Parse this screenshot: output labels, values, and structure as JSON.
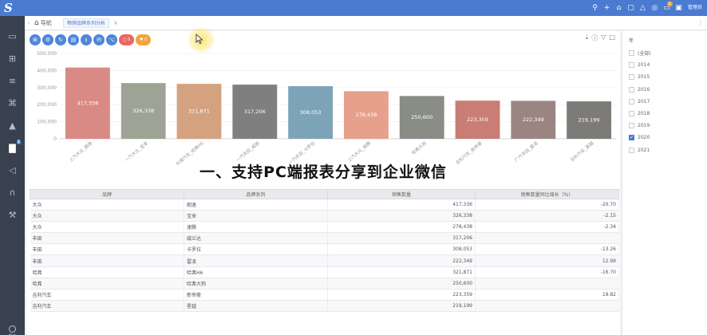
{
  "app": {
    "tab_home_label": "导航",
    "tab_active_label": "畅销品牌系列分析",
    "user_label": "管理员",
    "sidebar_bottom_label": "导航",
    "notification_badge": "5",
    "sidebar_badge": "1"
  },
  "toolbar": {
    "btn_count_a": "0",
    "btn_count_b": "0"
  },
  "banner": "一、支持PC端报表分享到企业微信",
  "chart_data": {
    "type": "bar",
    "categories": [
      "上汽大众_朗逸",
      "一汽大众_宝来",
      "长城汽车_哈弗H6",
      "一汽丰田_威驰",
      "一汽丰田_卡罗拉",
      "上汽大众_速腾",
      "哈弗大狗",
      "吉利汽车_新帝豪",
      "广汽丰田_雷凌",
      "吉利汽车_豪越"
    ],
    "values": [
      417336,
      326338,
      321871,
      317206,
      308053,
      278438,
      250600,
      223359,
      222349,
      219199
    ],
    "value_labels": [
      "417,336",
      "326,338",
      "321,871",
      "317,206",
      "308,053",
      "278,438",
      "250,600",
      "223,359",
      "222,349",
      "219,199"
    ],
    "colors": [
      "#d98a85",
      "#9ea495",
      "#d4a27f",
      "#7f7f7f",
      "#7da3b8",
      "#e6a08c",
      "#8a8d85",
      "#c97d74",
      "#9b8582",
      "#7c7b78"
    ],
    "yticks": [
      "0",
      "100,000",
      "200,000",
      "300,000",
      "400,000",
      "500,000"
    ],
    "ylim": [
      0,
      500000
    ]
  },
  "table": {
    "headers": [
      "品牌",
      "品牌系列",
      "销售数量",
      "销售数量同比增长（%）"
    ],
    "rows": [
      [
        "大众",
        "朗逸",
        "417,336",
        "-20.70"
      ],
      [
        "大众",
        "宝来",
        "326,338",
        "-2.15"
      ],
      [
        "大众",
        "速腾",
        "278,438",
        "-2.34"
      ],
      [
        "丰田",
        "威兰达",
        "317,206",
        ""
      ],
      [
        "丰田",
        "卡罗拉",
        "308,053",
        "-13.26"
      ],
      [
        "丰田",
        "雷凌",
        "222,349",
        "12.99"
      ],
      [
        "哈弗",
        "哈弗H6",
        "321,871",
        "-16.70"
      ],
      [
        "哈弗",
        "哈弗大狗",
        "250,600",
        ""
      ],
      [
        "吉利汽车",
        "新帝豪",
        "223,359",
        "19.82"
      ],
      [
        "吉利汽车",
        "星越",
        "219,199",
        ""
      ]
    ]
  },
  "filter": {
    "title": "年",
    "items": [
      {
        "label": "(全部)",
        "checked": false
      },
      {
        "label": "2014",
        "checked": false
      },
      {
        "label": "2015",
        "checked": false
      },
      {
        "label": "2016",
        "checked": false
      },
      {
        "label": "2017",
        "checked": false
      },
      {
        "label": "2018",
        "checked": false
      },
      {
        "label": "2019",
        "checked": false
      },
      {
        "label": "2020",
        "checked": true
      },
      {
        "label": "2021",
        "checked": false
      }
    ]
  }
}
